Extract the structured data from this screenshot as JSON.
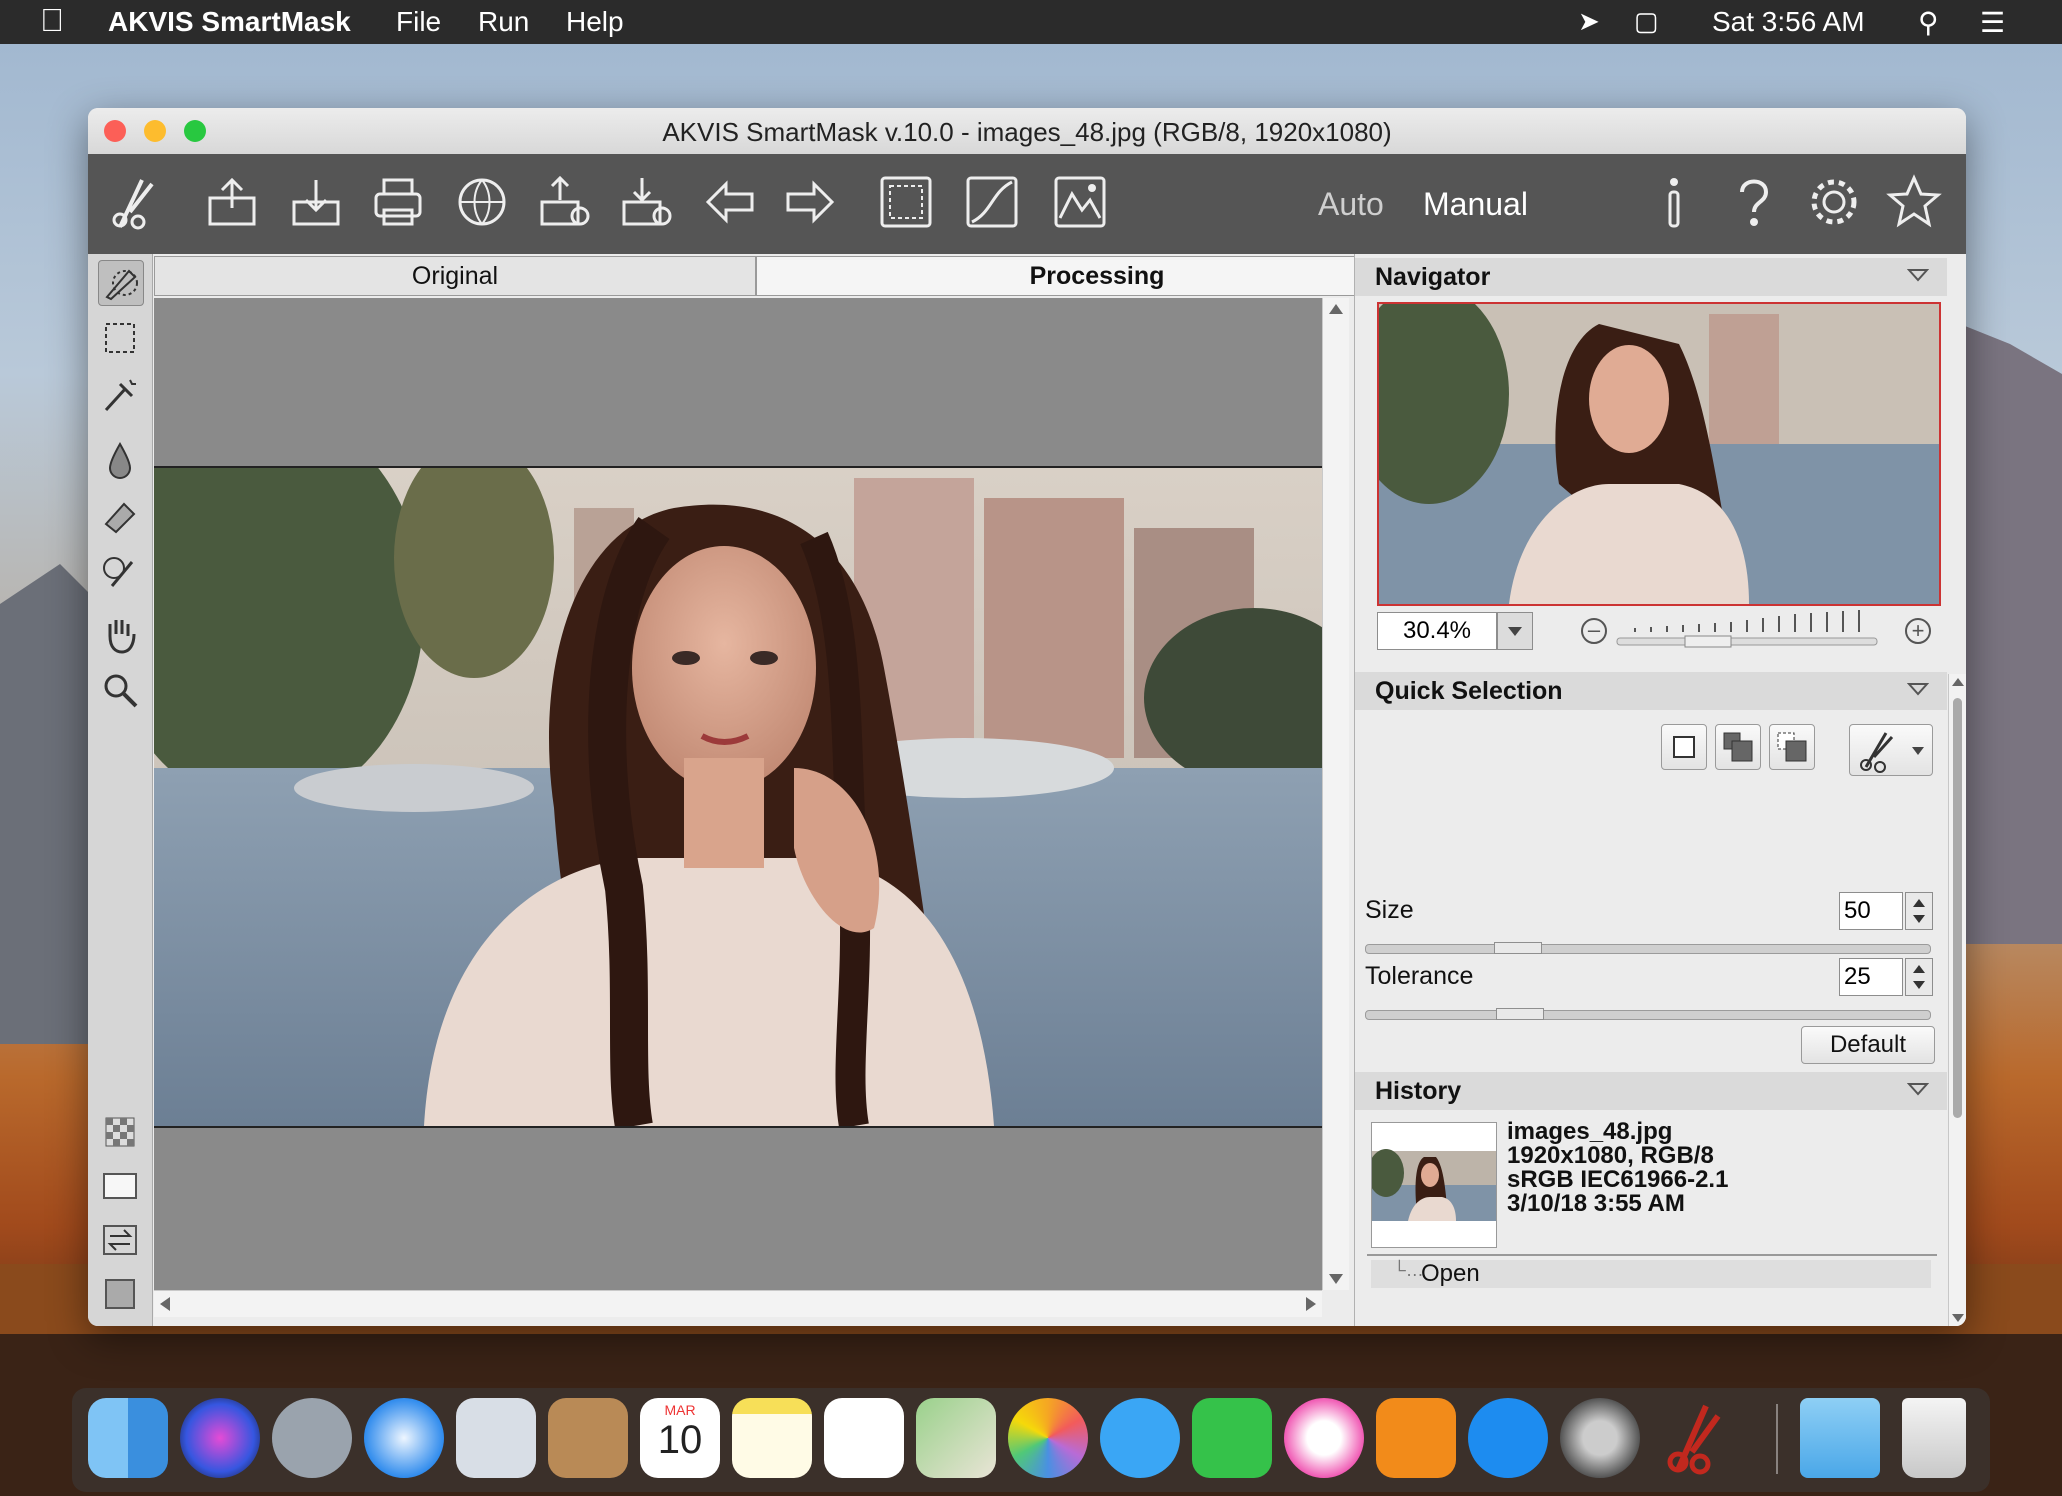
{
  "menubar": {
    "apple_icon": "apple-icon",
    "app_name": "AKVIS SmartMask",
    "menus": [
      "File",
      "Run",
      "Help"
    ],
    "clock": "Sat 3:56 AM"
  },
  "window": {
    "title": "AKVIS SmartMask v.10.0 - images_48.jpg (RGB/8, 1920x1080)"
  },
  "toolbar": {
    "mode_auto": "Auto",
    "mode_manual": "Manual"
  },
  "tabs": {
    "original": "Original",
    "processing": "Processing"
  },
  "navigator": {
    "title": "Navigator",
    "zoom": "30.4%"
  },
  "quick_selection": {
    "title": "Quick Selection",
    "size_label": "Size",
    "size_value": "50",
    "tolerance_label": "Tolerance",
    "tolerance_value": "25",
    "default_button": "Default"
  },
  "history": {
    "title": "History",
    "file_name": "images_48.jpg",
    "line2": "1920x1080, RGB/8",
    "line3": "sRGB IEC61966-2.1",
    "line4": "3/10/18 3:55 AM",
    "step": "Open"
  },
  "dock": {
    "calendar_month": "MAR",
    "calendar_day": "10"
  },
  "colors": {
    "toolbar_bg": "#555555",
    "menubar_bg": "#2b2b2b",
    "close": "#fc5f57",
    "minimize": "#fdbc2e",
    "zoom": "#28c840",
    "canvas_bg": "#8a8a8a"
  }
}
